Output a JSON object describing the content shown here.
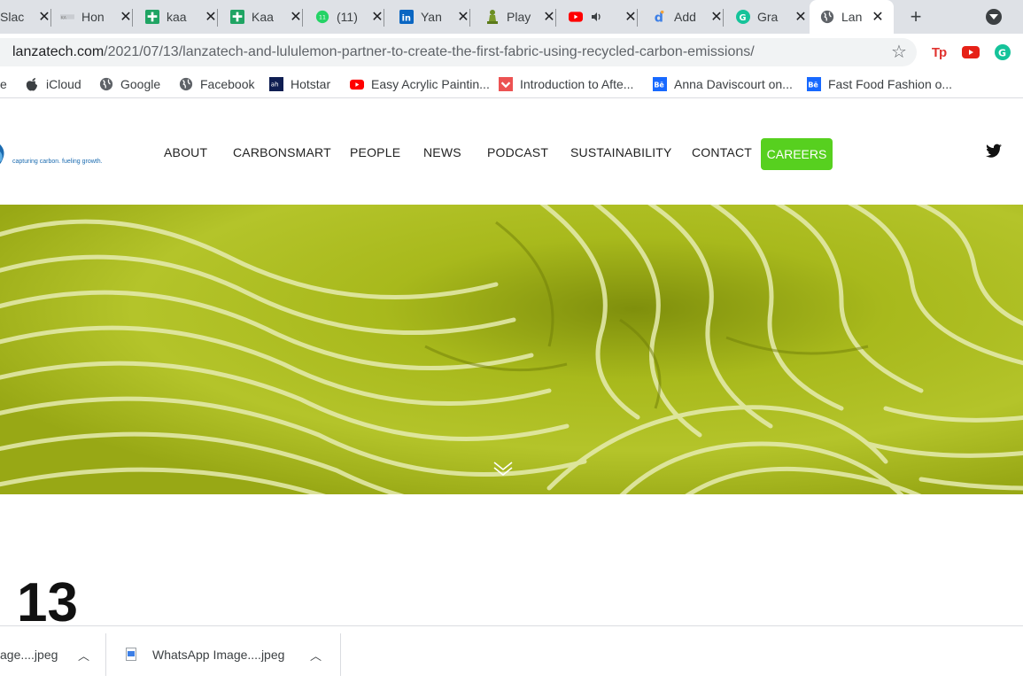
{
  "browser": {
    "tabs": [
      {
        "label": "Slac",
        "icon": "slack-icon"
      },
      {
        "label": "Hon",
        "icon": "khan-icon"
      },
      {
        "label": "kaa",
        "icon": "sheets-icon"
      },
      {
        "label": "Kaa",
        "icon": "sheets-icon"
      },
      {
        "label": "(11)",
        "icon": "whatsapp-icon"
      },
      {
        "label": "Yan",
        "icon": "linkedin-icon"
      },
      {
        "label": "Play",
        "icon": "chess-pawn-icon"
      },
      {
        "label": "",
        "icon": "youtube-icon"
      },
      {
        "label": "Add",
        "icon": "dropbox-icon"
      },
      {
        "label": "Gra",
        "icon": "grammarly-icon"
      },
      {
        "label": "Lan",
        "icon": "globe-icon"
      }
    ],
    "new_tab_label": "+",
    "url": {
      "domain": "lanzatech.com",
      "path": "/2021/07/13/lanzatech-and-lululemon-partner-to-create-the-first-fabric-using-recycled-carbon-emissions/"
    },
    "extensions": [
      {
        "name": "tp-extension-icon",
        "label": "Tp",
        "color": "#e0332f"
      },
      {
        "name": "youtube-extension-icon",
        "label": "",
        "color": "#ff0000"
      },
      {
        "name": "grammarly-extension-icon",
        "label": "",
        "color": "#15c39a"
      }
    ],
    "bookmarks": [
      {
        "label": "e",
        "icon": "none"
      },
      {
        "label": "iCloud",
        "icon": "apple-icon"
      },
      {
        "label": "Google",
        "icon": "globe-icon"
      },
      {
        "label": "Facebook",
        "icon": "globe-icon"
      },
      {
        "label": "Hotstar",
        "icon": "hotstar-icon"
      },
      {
        "label": "Easy Acrylic Paintin...",
        "icon": "youtube-icon"
      },
      {
        "label": "Introduction to Afte...",
        "icon": "udemy-icon"
      },
      {
        "label": "Anna Daviscourt on...",
        "icon": "behance-icon"
      },
      {
        "label": "Fast Food Fashion o...",
        "icon": "behance-icon"
      }
    ],
    "downloads": [
      {
        "label": "age....jpeg"
      },
      {
        "label": "WhatsApp Image....jpeg"
      }
    ]
  },
  "site": {
    "logo_tagline": "capturing carbon. fueling growth.",
    "nav": [
      {
        "label": "ABOUT"
      },
      {
        "label": "CARBONSMART"
      },
      {
        "label": "PEOPLE"
      },
      {
        "label": "NEWS"
      },
      {
        "label": "PODCAST"
      },
      {
        "label": "SUSTAINABILITY"
      },
      {
        "label": "CONTACT"
      }
    ],
    "cta_label": "CAREERS",
    "accent_color": "#57d01f",
    "hero_color": "#9dad17",
    "date_day": "13"
  }
}
